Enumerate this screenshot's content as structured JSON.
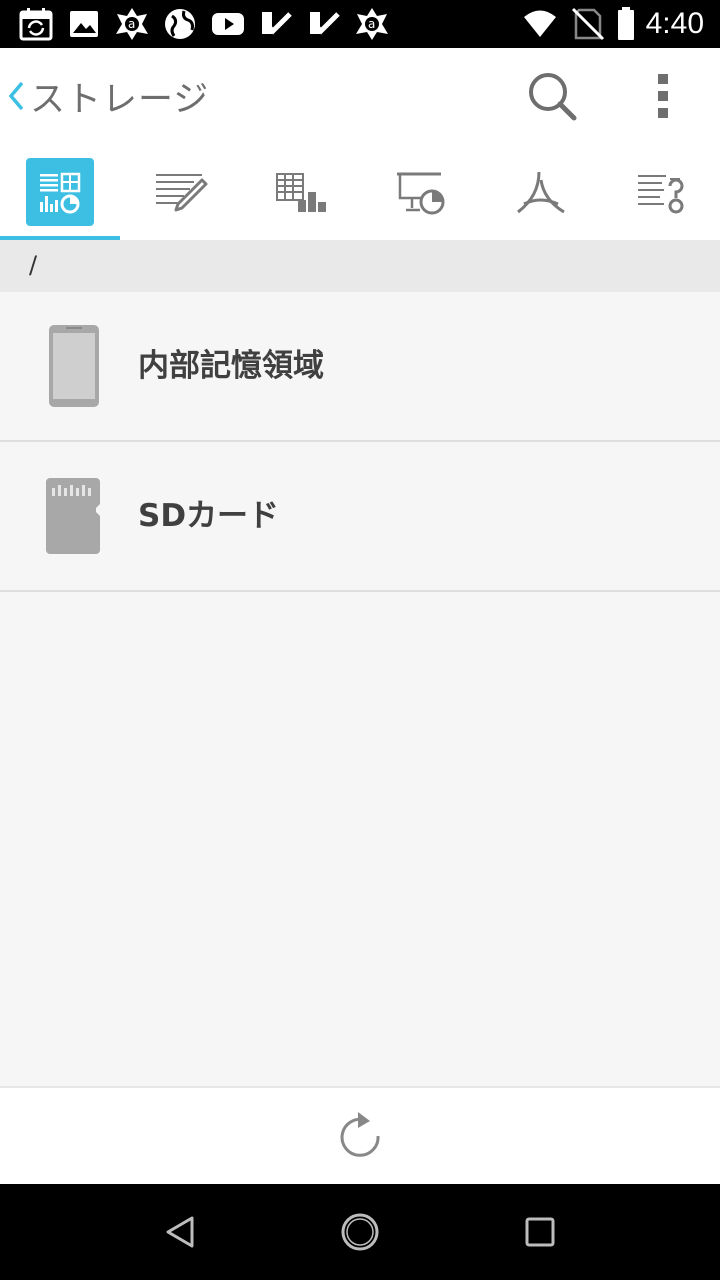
{
  "status_bar": {
    "time": "4:40",
    "left_icons": [
      "calendar-sync-icon",
      "gallery-icon",
      "avast-icon",
      "globe-icon",
      "youtube-icon",
      "check-app-icon",
      "check-app-icon",
      "avast-icon"
    ],
    "right_icons": [
      "wifi-icon",
      "no-sim-icon",
      "battery-icon"
    ]
  },
  "app_bar": {
    "title": "ストレージ",
    "back_icon": "chevron-left-icon",
    "search_icon": "search-icon",
    "menu_icon": "more-vert-icon"
  },
  "tabs": [
    {
      "name": "all-documents",
      "icon": "all-docs-icon",
      "active": true
    },
    {
      "name": "text-documents",
      "icon": "writer-icon",
      "active": false
    },
    {
      "name": "spreadsheets",
      "icon": "spreadsheet-icon",
      "active": false
    },
    {
      "name": "presentations",
      "icon": "presentation-icon",
      "active": false
    },
    {
      "name": "pdf",
      "icon": "pdf-icon",
      "active": false
    },
    {
      "name": "other",
      "icon": "text-other-icon",
      "active": false
    }
  ],
  "path": "/",
  "storage_items": [
    {
      "label": "内部記憶領域",
      "icon": "phone-icon"
    },
    {
      "label": "SDカード",
      "icon": "sd-card-icon"
    }
  ],
  "bottom_bar": {
    "refresh_icon": "refresh-icon"
  },
  "colors": {
    "accent": "#3dbfe3",
    "icon_gray": "#7a7a7a",
    "storage_icon_gray": "#a8a8a8",
    "background": "#f6f6f6"
  }
}
